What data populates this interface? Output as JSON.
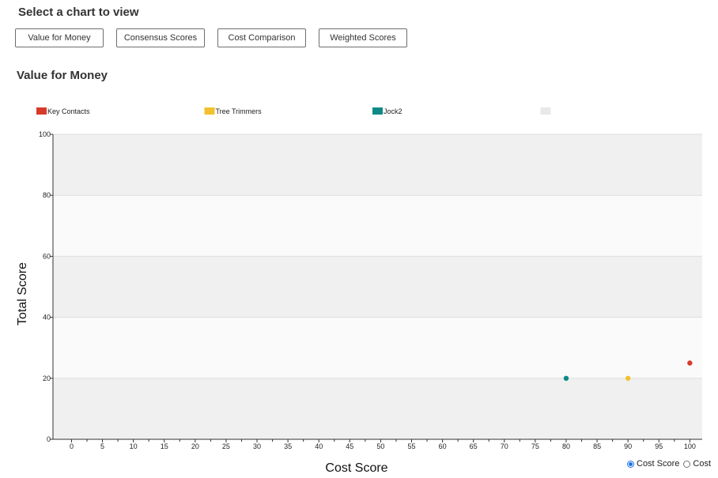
{
  "header": {
    "title": "Select a chart to view"
  },
  "buttons": [
    {
      "label": "Value for Money"
    },
    {
      "label": "Consensus Scores"
    },
    {
      "label": "Cost Comparison"
    },
    {
      "label": "Weighted Scores"
    }
  ],
  "chart_data": {
    "type": "scatter",
    "title": "Value for Money",
    "xlabel": "Cost Score",
    "ylabel": "Total Score",
    "xlim": [
      -3,
      102
    ],
    "ylim": [
      0,
      100
    ],
    "x_ticks": [
      0,
      5,
      10,
      15,
      20,
      25,
      30,
      35,
      40,
      45,
      50,
      55,
      60,
      65,
      70,
      75,
      80,
      85,
      90,
      95,
      100
    ],
    "y_ticks": [
      0,
      20,
      40,
      60,
      80,
      100
    ],
    "legend_position": "top",
    "grid": true,
    "series": [
      {
        "name": "Key Contacts",
        "color": "#d83a2a",
        "x": [
          100
        ],
        "y": [
          25
        ]
      },
      {
        "name": "Tree Trimmers",
        "color": "#f2c12e",
        "x": [
          90
        ],
        "y": [
          20
        ]
      },
      {
        "name": "Jock2",
        "color": "#0e8a86",
        "x": [
          80
        ],
        "y": [
          20
        ]
      },
      {
        "name": "",
        "color": "#e8e8e8",
        "x": [],
        "y": []
      }
    ],
    "band_colors": [
      "#f0f0f0",
      "#fafafa"
    ]
  },
  "toggle": {
    "options": [
      {
        "label": "Cost Score",
        "selected": true
      },
      {
        "label": "Cost",
        "selected": false
      }
    ]
  }
}
